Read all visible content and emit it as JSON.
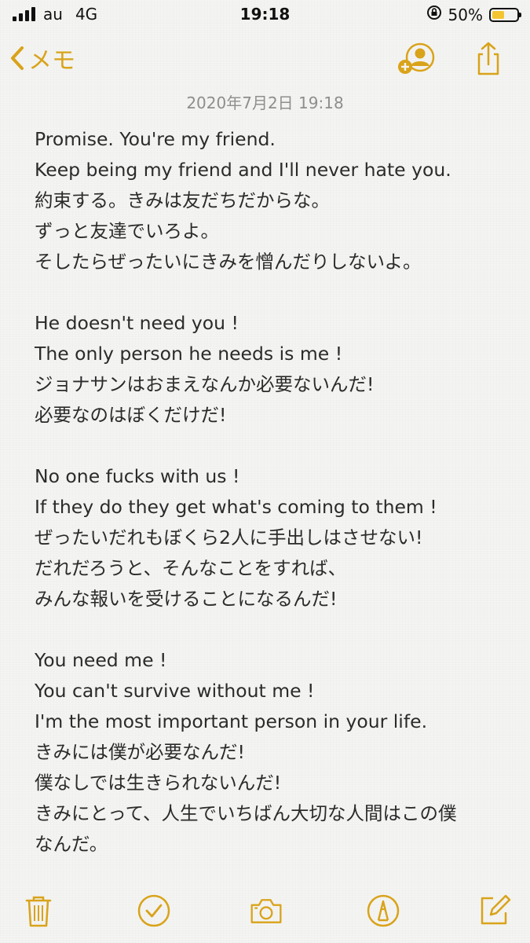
{
  "status_bar": {
    "carrier": "au",
    "network": "4G",
    "time": "19:18",
    "battery_percent_label": "50%",
    "battery_level": 0.5,
    "accent_color": "#f4c531"
  },
  "nav": {
    "back_label": "メモ",
    "accent_color": "#d9a31a",
    "icons": [
      "chevron-left-icon",
      "add-person-icon",
      "share-icon"
    ]
  },
  "note": {
    "timestamp": "2020年7月2日 19:18",
    "lines": [
      "Promise. You're my friend.",
      "Keep being my friend and I'll never hate you.",
      "約束する。きみは友だちだからな。",
      "ずっと友達でいろよ。",
      "そしたらぜったいにきみを憎んだりしないよ。",
      "",
      "He doesn't need you !",
      "The only person he needs is me !",
      "ジョナサンはおまえなんか必要ないんだ!",
      "必要なのはぼくだけだ!",
      "",
      "No one fucks with us !",
      "If they do they get what's coming to them !",
      "ぜったいだれもぼくら2人に手出しはさせない!",
      "だれだろうと、そんなことをすれば、",
      "みんな報いを受けることになるんだ!",
      "",
      "You need me !",
      "You can't survive without me !",
      "I'm the most important person in your life.",
      "きみには僕が必要なんだ!",
      "僕なしでは生きられないんだ!",
      "きみにとって、人生でいちばん大切な人間はこの僕",
      "なんだ。"
    ]
  },
  "toolbar": {
    "icons": [
      "trash-icon",
      "checklist-icon",
      "camera-icon",
      "markup-icon",
      "compose-icon"
    ]
  }
}
